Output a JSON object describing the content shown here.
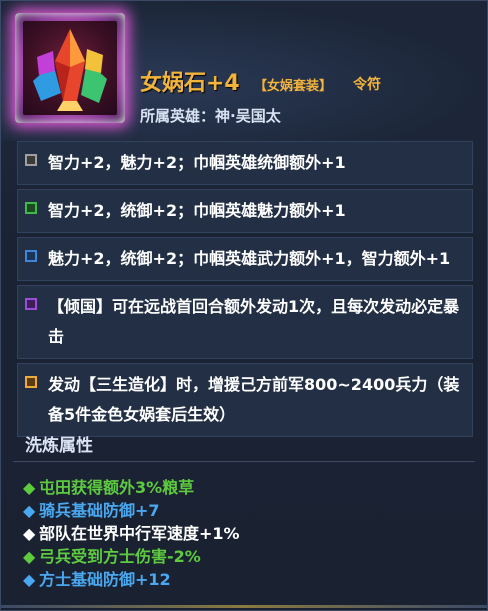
{
  "item": {
    "name": "女娲石+4",
    "tag": "【女娲套装】",
    "type": "令符",
    "hero_label": "所属英雄：",
    "hero_name": "神·吴国太"
  },
  "effects": [
    {
      "text": "智力+2，魅力+2；巾帼英雄统御额外+1",
      "color": "#a0a0a0"
    },
    {
      "text": "智力+2，统御+2；巾帼英雄魅力额外+1",
      "color": "#41b84a"
    },
    {
      "text": "魅力+2，统御+2；巾帼英雄武力额外+1，智力额外+1",
      "color": "#3f86d8"
    },
    {
      "text": "【倾国】可在远战首回合额外发动1次，且每次发动必定暴击",
      "color": "#9c4fd6"
    },
    {
      "text": "发动【三生造化】时，增援己方前军800~2400兵力（装备5件金色女娲套后生效）",
      "color": "#f0a838"
    }
  ],
  "refine": {
    "title": "洗炼属性",
    "items": [
      {
        "text": "屯田获得额外3%粮草",
        "color": "#5ecb3f"
      },
      {
        "text": "骑兵基础防御+7",
        "color": "#4aa8f0"
      },
      {
        "text": "部队在世界中行军速度+1%",
        "color": "#ffffff"
      },
      {
        "text": "弓兵受到方士伤害-2%",
        "color": "#5ecb3f"
      },
      {
        "text": "方士基础防御+12",
        "color": "#4aa8f0"
      }
    ],
    "bullet": "◆"
  }
}
